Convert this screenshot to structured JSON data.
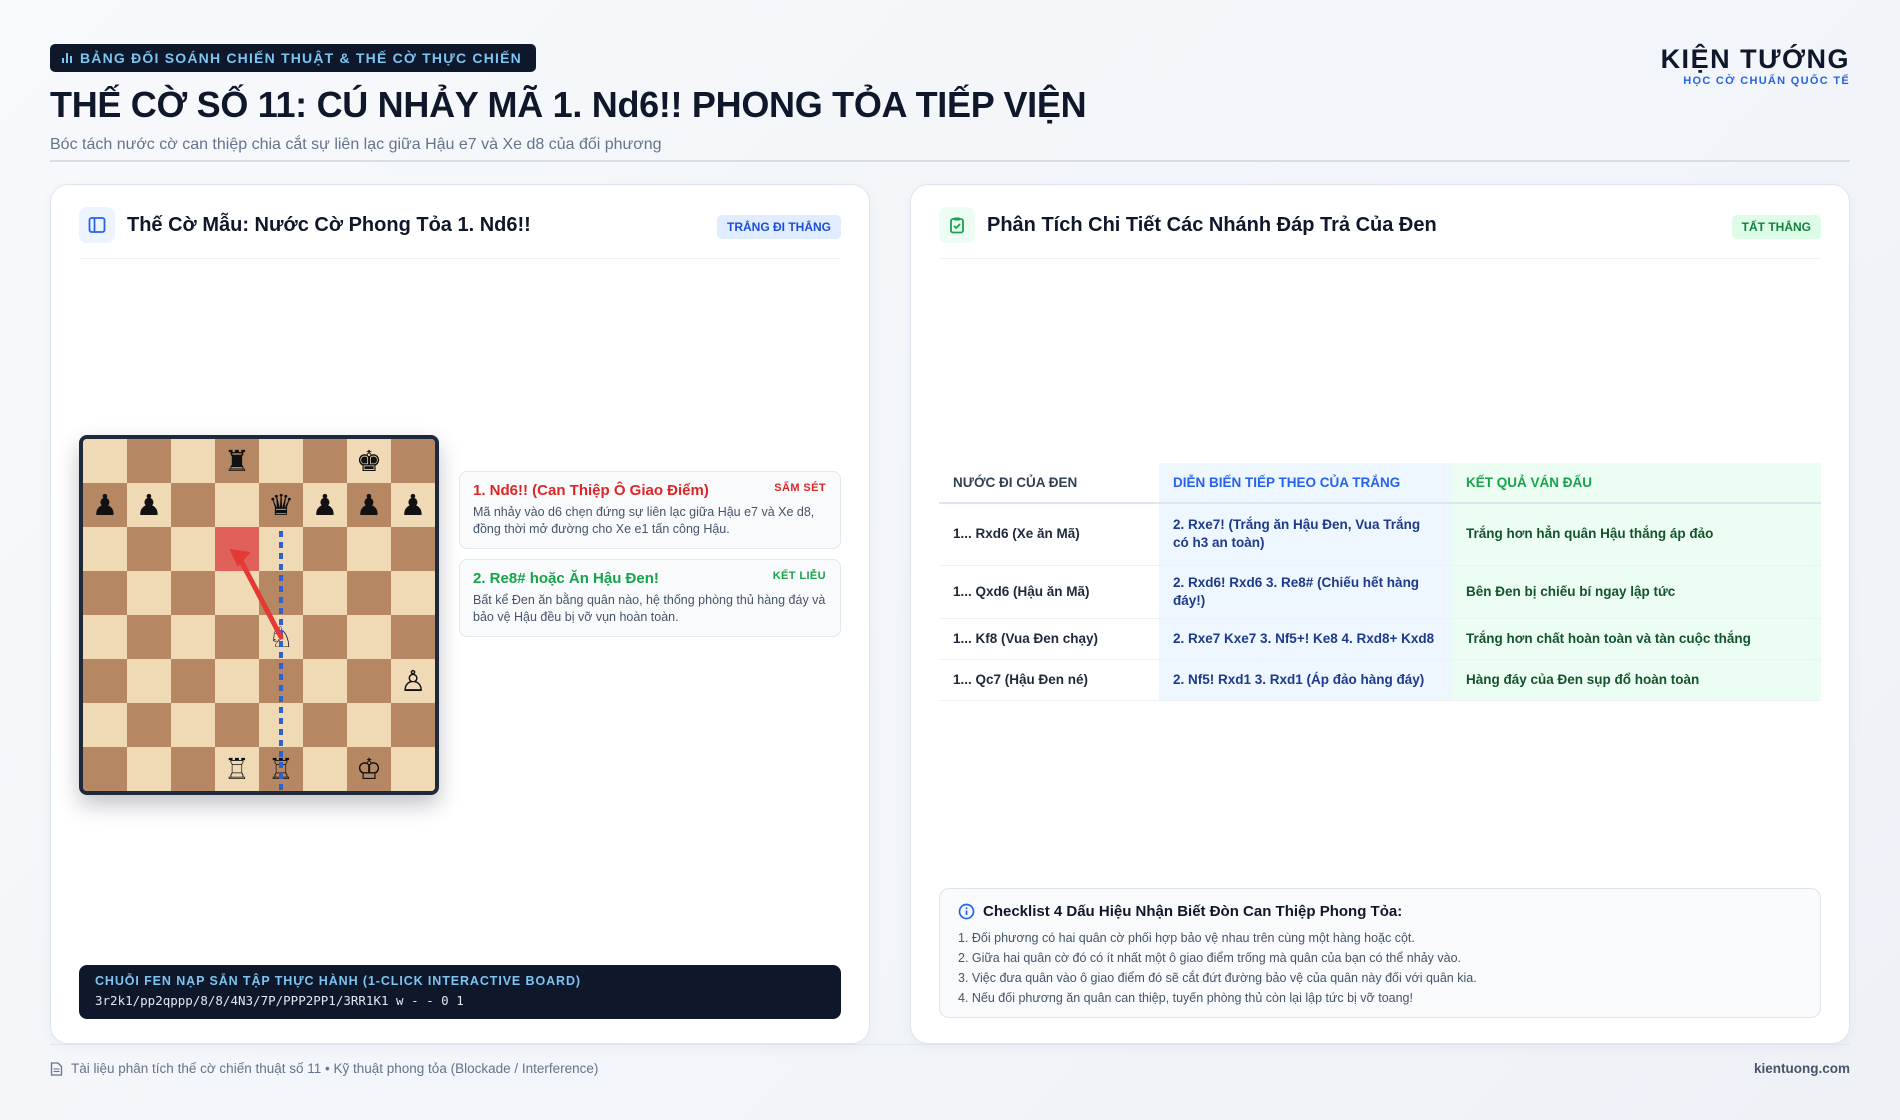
{
  "header": {
    "tag": "BẢNG ĐỐI SOÁNH CHIẾN THUẬT & THẾ CỜ THỰC CHIẾN",
    "title": "THẾ CỜ SỐ 11: CÚ NHẢY MÃ 1. Nd6!! PHONG TỎA TIẾP VIỆN",
    "subtitle": "Bóc tách nước cờ can thiệp chia cắt sự liên lạc giữa Hậu e7 và Xe d8 của đối phương"
  },
  "brand": {
    "name": "KIỆN TƯỚNG",
    "tagline": "HỌC CỜ CHUẨN QUỐC TẾ"
  },
  "left_panel": {
    "title": "Thế Cờ Mẫu: Nước Cờ Phong Tỏa 1. Nd6!!",
    "badge": "TRẮNG ĐI THẮNG",
    "board": {
      "rows": [
        [
          "",
          "",
          "",
          "♜",
          "",
          "",
          "♚",
          ""
        ],
        [
          "♟",
          "♟",
          "",
          "",
          "♛",
          "♟",
          "♟",
          "♟"
        ],
        [
          "",
          "",
          "",
          "",
          "",
          "",
          "",
          ""
        ],
        [
          "",
          "",
          "",
          "",
          "",
          "",
          "",
          ""
        ],
        [
          "",
          "",
          "",
          "",
          "♘",
          "",
          "",
          ""
        ],
        [
          "",
          "",
          "",
          "",
          "",
          "",
          "",
          "♙"
        ],
        [
          "",
          "",
          "",
          "",
          "",
          "",
          "",
          ""
        ],
        [
          "",
          "",
          "",
          "♖",
          "♖",
          "",
          "♔",
          ""
        ]
      ],
      "highlight_square": "d6",
      "arrow": {
        "from": "e4",
        "to": "d6"
      },
      "dashed_line": {
        "from": "e8",
        "to": "e1"
      }
    },
    "notes": [
      {
        "title": "1. Nd6!! (Can Thiệp Ô Giao Điểm)",
        "badge": "SẤM SÉT",
        "desc": "Mã nhảy vào d6 chẹn đứng sự liên lạc giữa Hậu e7 và Xe d8, đồng thời mở đường cho Xe e1 tấn công Hậu.",
        "color": "#dc2626"
      },
      {
        "title": "2. Re8# hoặc Ăn Hậu Đen!",
        "badge": "KẾT LIỄU",
        "desc": "Bất kể Đen ăn bằng quân nào, hệ thống phòng thủ hàng đáy và bảo vệ Hậu đều bị vỡ vụn hoàn toàn.",
        "color": "#16a34a"
      }
    ],
    "fen": {
      "label": "CHUỖI FEN NẠP SẴN TẬP THỰC HÀNH (1-CLICK INTERACTIVE BOARD)",
      "value": "3r2k1/pp2qppp/8/8/4N3/7P/PPP2PP1/3RR1K1 w - - 0 1"
    }
  },
  "right_panel": {
    "title": "Phân Tích Chi Tiết Các Nhánh Đáp Trả Của Đen",
    "badge": "TẤT THẮNG",
    "table": {
      "headers": [
        "NƯỚC ĐI CỦA ĐEN",
        "DIỄN BIẾN TIẾP THEO CỦA TRẮNG",
        "KẾT QUẢ VÁN ĐẤU"
      ],
      "rows": [
        [
          "1... Rxd6 (Xe ăn Mã)",
          "2. Rxe7! (Trắng ăn Hậu Đen, Vua Trắng có h3 an toàn)",
          "Trắng hơn hẳn quân Hậu thắng áp đảo"
        ],
        [
          "1... Qxd6 (Hậu ăn Mã)",
          "2. Rxd6! Rxd6 3. Re8# (Chiếu hết hàng đáy!)",
          "Bên Đen bị chiếu bí ngay lập tức"
        ],
        [
          "1... Kf8 (Vua Đen chạy)",
          "2. Rxe7 Kxe7 3. Nf5+! Ke8 4. Rxd8+ Kxd8",
          "Trắng hơn chất hoàn toàn và tàn cuộc thắng"
        ],
        [
          "1... Qc7 (Hậu Đen né)",
          "2. Nf5! Rxd1 3. Rxd1 (Áp đảo hàng đáy)",
          "Hàng đáy của Đen sụp đổ hoàn toàn"
        ]
      ]
    },
    "checklist": {
      "title": "Checklist 4 Dấu Hiệu Nhận Biết Đòn Can Thiệp Phong Tỏa:",
      "items": [
        "1. Đối phương có hai quân cờ phối hợp bảo vệ nhau trên cùng một hàng hoặc cột.",
        "2. Giữa hai quân cờ đó có ít nhất một ô giao điểm trống mà quân của bạn có thể nhảy vào.",
        "3. Việc đưa quân vào ô giao điểm đó sẽ cắt đứt đường bảo vệ của quân này đối với quân kia.",
        "4. Nếu đối phương ăn quân can thiệp, tuyến phòng thủ còn lại lập tức bị vỡ toang!"
      ]
    }
  },
  "footer": {
    "left": "Tài liệu phân tích thế cờ chiến thuật số 11 • Kỹ thuật phong tỏa (Blockade / Interference)",
    "right": "kientuong.com"
  },
  "colors": {
    "navy": "#0f172a",
    "accent_blue": "#2563eb",
    "danger_red": "#dc2626",
    "success_green": "#16a34a",
    "light_square": "#f0d9b5",
    "dark_square": "#b58863"
  }
}
